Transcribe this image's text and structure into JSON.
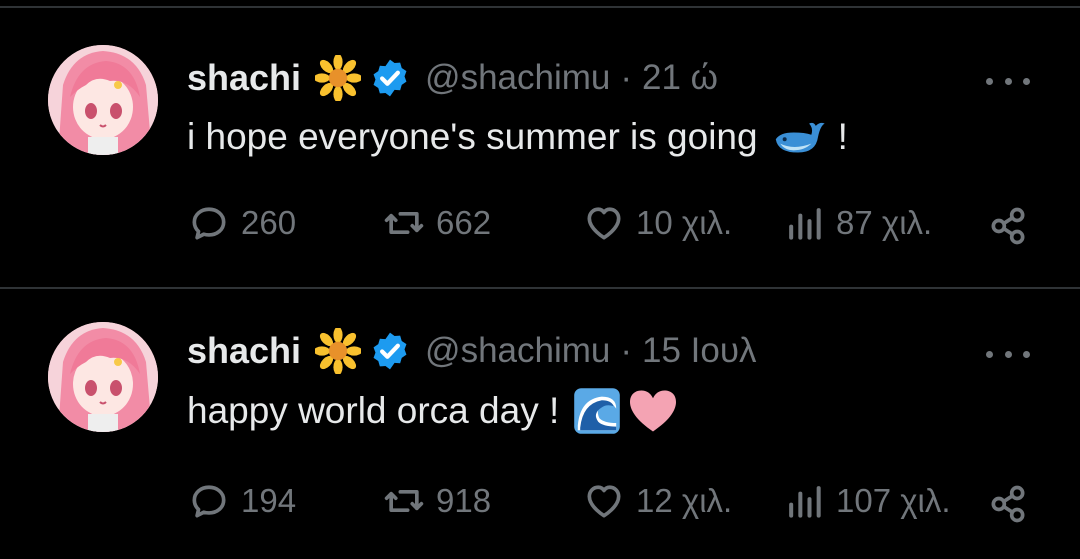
{
  "tweets": [
    {
      "name": "shachi",
      "handle": "@shachimu",
      "separator": "·",
      "time": "21 ώ",
      "text": "i hope everyone's summer is going",
      "text_suffix": "!",
      "emojis": [
        "whale-emoji"
      ],
      "stats": {
        "replies": "260",
        "retweets": "662",
        "likes": "10 χιλ.",
        "views": "87 χιλ."
      }
    },
    {
      "name": "shachi",
      "handle": "@shachimu",
      "separator": "·",
      "time": "15 Ιουλ",
      "text": "happy world orca day !",
      "text_suffix": "",
      "emojis": [
        "wave-emoji",
        "pink-heart-emoji"
      ],
      "stats": {
        "replies": "194",
        "retweets": "918",
        "likes": "12 χιλ.",
        "views": "107 χιλ."
      }
    }
  ],
  "colors": {
    "background": "#000000",
    "text": "#e7e9ea",
    "muted": "#71767b",
    "verified": "#1d9bf0",
    "divider": "#2f3336"
  },
  "icons": [
    "sunflower-icon",
    "verified-badge-icon",
    "more-icon",
    "reply-icon",
    "retweet-icon",
    "like-icon",
    "views-icon",
    "share-icon"
  ]
}
